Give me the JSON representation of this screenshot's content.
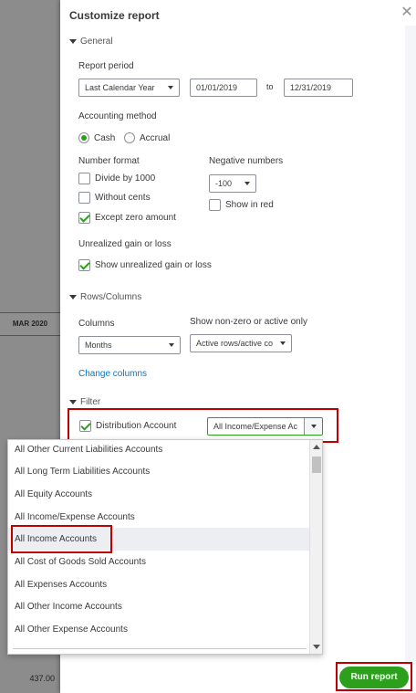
{
  "background": {
    "column_header": "MAR 2020",
    "bottom_value": "437.00"
  },
  "panel": {
    "title": "Customize report"
  },
  "general": {
    "heading": "General",
    "report_period_label": "Report period",
    "report_period_value": "Last Calendar Year",
    "start_date": "01/01/2019",
    "to_label": "to",
    "end_date": "12/31/2019",
    "accounting_method_label": "Accounting method",
    "cash_label": "Cash",
    "accrual_label": "Accrual",
    "method_selected": "Cash",
    "number_format_label": "Number format",
    "divide_label": "Divide by 1000",
    "without_cents_label": "Without cents",
    "except_zero_label": "Except zero amount",
    "negative_numbers_label": "Negative numbers",
    "negative_value": "-100",
    "show_in_red_label": "Show in red",
    "unrealized_label": "Unrealized gain or loss",
    "show_unrealized_label": "Show unrealized gain or loss"
  },
  "rows_columns": {
    "heading": "Rows/Columns",
    "columns_label": "Columns",
    "columns_value": "Months",
    "show_label": "Show non-zero or active only",
    "show_value": "Active rows/active co",
    "change_columns_link": "Change columns"
  },
  "filter": {
    "heading": "Filter",
    "distribution_label": "Distribution Account",
    "distribution_value": "All Income/Expense Ac"
  },
  "dropdown": {
    "items": [
      "All Other Current Liabilities Accounts",
      "All Long Term Liabilities Accounts",
      "All Equity Accounts",
      "All Income/Expense Accounts",
      "All Income Accounts",
      "All Cost of Goods Sold Accounts",
      "All Expenses Accounts",
      "All Other Income Accounts",
      "All Other Expense Accounts"
    ],
    "highlighted": "All Income Accounts"
  },
  "footer": {
    "run_report_label": "Run report"
  },
  "colors": {
    "accent_green": "#2ca01c",
    "link_blue": "#0077c5",
    "highlight_red": "#c00000"
  }
}
